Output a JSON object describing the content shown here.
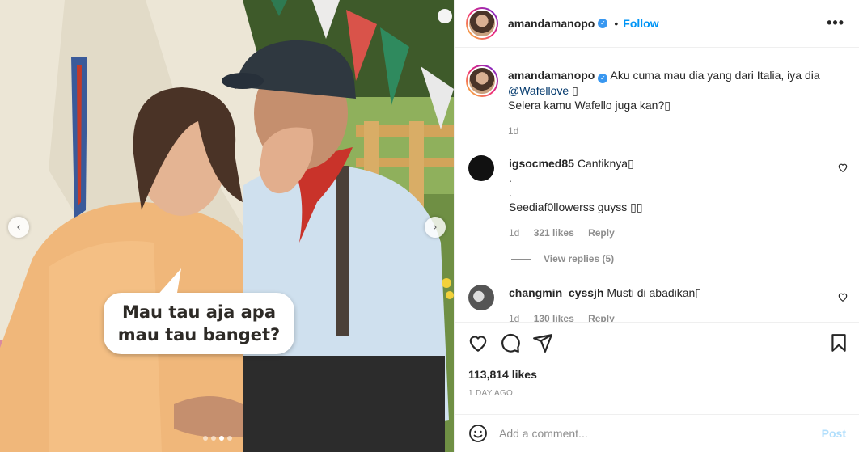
{
  "media": {
    "bubble_text": "Mau tau aja apa\nmau tau banget?",
    "prev_arrow": "‹",
    "next_arrow": "›",
    "slide_count": 4,
    "active_slide": 2
  },
  "header": {
    "username": "amandamanopo",
    "verified_glyph": "✓",
    "separator": "•",
    "follow_label": "Follow",
    "more_label": "•••"
  },
  "caption": {
    "username": "amandamanopo",
    "text_1": "Aku cuma mau dia yang dari Italia, iya dia",
    "mention": "@Wafellove",
    "emoji_1": "▯",
    "line_2": "Selera kamu Wafello juga kan?▯",
    "age": "1d"
  },
  "comments": [
    {
      "username": "igsocmed85",
      "lines": [
        "Cantiknya▯",
        ".",
        ".",
        "Seediaf0llowerss guyss ▯▯"
      ],
      "age": "1d",
      "likes": "321 likes",
      "reply_label": "Reply",
      "view_replies": "View replies (5)"
    },
    {
      "username": "changmin_cyssjh",
      "lines": [
        "Musti di abadikan▯"
      ],
      "age": "1d",
      "likes": "130 likes",
      "reply_label": "Reply"
    }
  ],
  "actions": {
    "likes_count": "113,814 likes",
    "timestamp": "1 DAY AGO"
  },
  "add_comment": {
    "placeholder": "Add a comment...",
    "post_label": "Post"
  },
  "colors": {
    "accent": "#0095f6",
    "post_disabled": "#b2dffc",
    "muted": "#8e8e8e"
  },
  "icons": [
    "more-options-icon",
    "heart-icon",
    "comment-icon",
    "share-icon",
    "bookmark-icon",
    "emoji-icon",
    "verified-icon"
  ]
}
